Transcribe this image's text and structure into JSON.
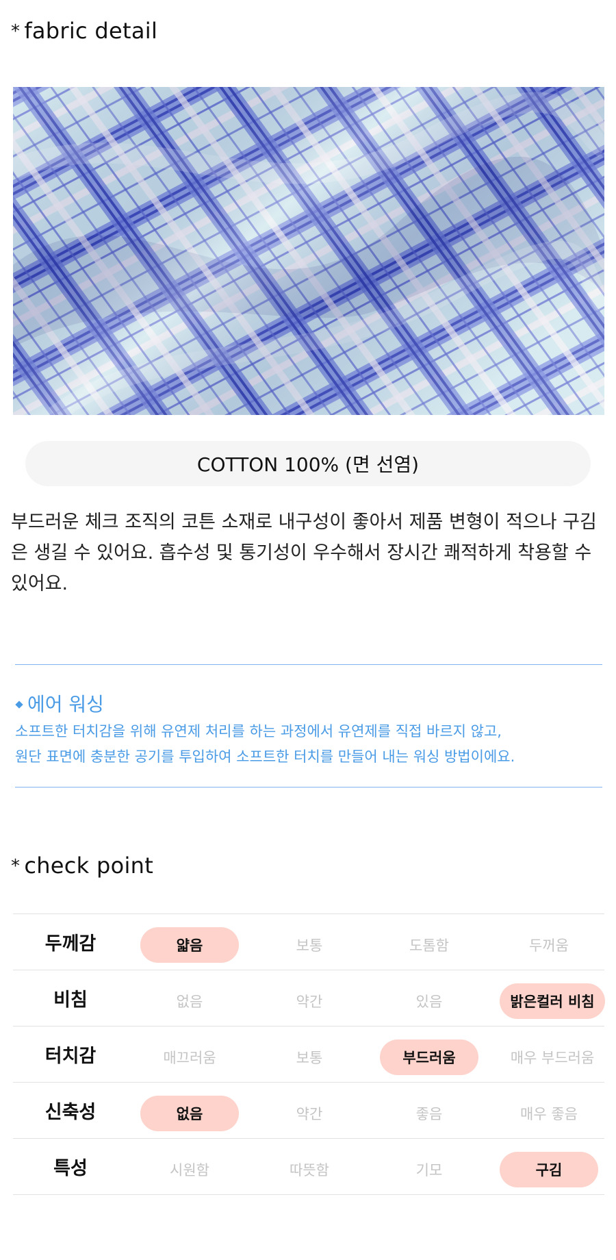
{
  "fabric_section": {
    "star": "*",
    "title": "fabric detail",
    "material": "COTTON 100% (면 선염)",
    "description": "부드러운 체크 조직의 코튼 소재로 내구성이 좋아서 제품 변형이 적으나 구김은 생길 수 있어요. 흡수성 및 통기성이 우수해서 장시간 쾌적하게 착용할 수 있어요.",
    "image_alt": "blue and light-blue plaid cotton fabric"
  },
  "air_washing": {
    "title": "에어 워싱",
    "line1": "소프트한 터치감을 위해 유연제 처리를 하는 과정에서 유연제를 직접 바르지 않고,",
    "line2": "원단 표면에 충분한 공기를 투입하여 소프트한 터치를 만들어 내는 워싱 방법이에요.",
    "color": "#4a9be6"
  },
  "check_section": {
    "star": "*",
    "title": "check point",
    "highlight_color": "#fdd3cb",
    "rows": [
      {
        "label": "두께감",
        "options": [
          "얇음",
          "보통",
          "도톰함",
          "두꺼움"
        ],
        "selected": 0
      },
      {
        "label": "비침",
        "options": [
          "없음",
          "약간",
          "있음",
          "밝은컬러 비침"
        ],
        "selected": 3
      },
      {
        "label": "터치감",
        "options": [
          "매끄러움",
          "보통",
          "부드러움",
          "매우 부드러움"
        ],
        "selected": 2
      },
      {
        "label": "신축성",
        "options": [
          "없음",
          "약간",
          "좋음",
          "매우 좋음"
        ],
        "selected": 0
      },
      {
        "label": "특성",
        "options": [
          "시원함",
          "따뜻함",
          "기모",
          "구김"
        ],
        "selected": 3
      }
    ]
  }
}
